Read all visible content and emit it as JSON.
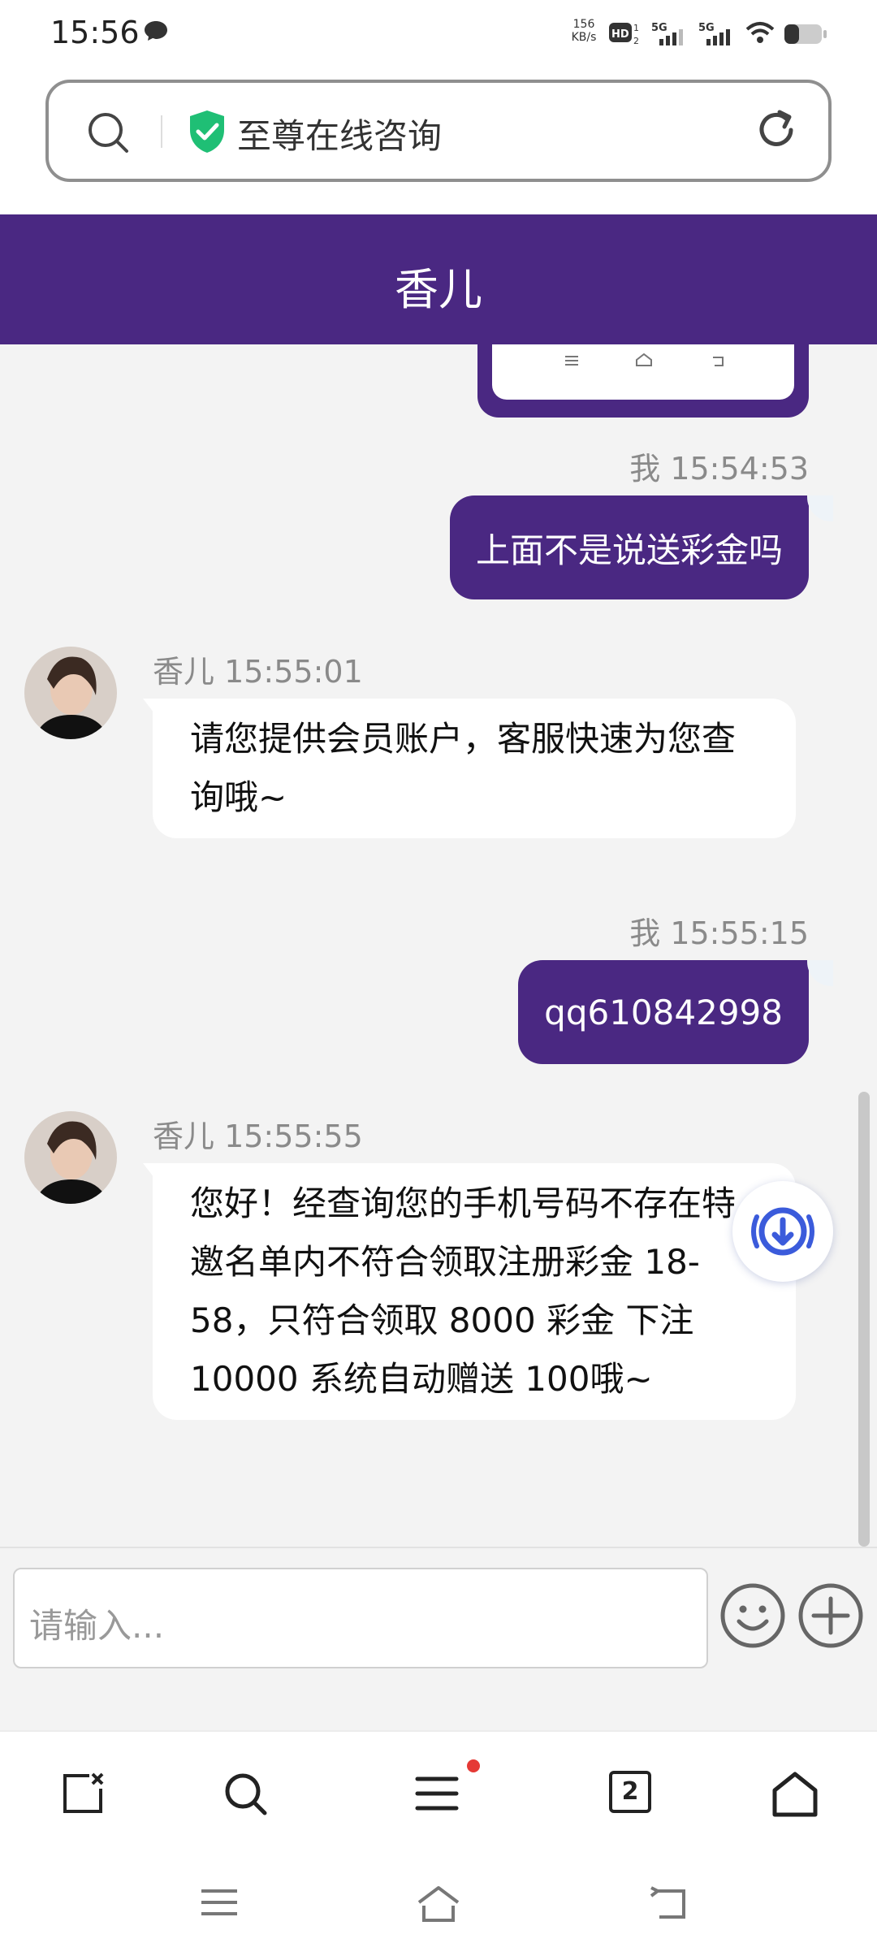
{
  "status_bar": {
    "time": "15:56",
    "net_speed_value": "156",
    "net_speed_unit": "KB/s",
    "hd_label": "HD",
    "sim1_label": "5G",
    "sim2_label": "5G"
  },
  "address_bar": {
    "title": "至尊在线咨询"
  },
  "chat": {
    "header_title": "香儿",
    "messages": [
      {
        "sender": "我",
        "time": "15:54:53",
        "meta": "我 15:54:53",
        "text": "上面不是说送彩金吗",
        "direction": "out"
      },
      {
        "sender": "香儿",
        "time": "15:55:01",
        "meta": "香儿 15:55:01",
        "text": "请您提供会员账户，客服快速为您查询哦~",
        "direction": "in"
      },
      {
        "sender": "我",
        "time": "15:55:15",
        "meta": "我 15:55:15",
        "text": "qq610842998",
        "direction": "out"
      },
      {
        "sender": "香儿",
        "time": "15:55:55",
        "meta": "香儿 15:55:55",
        "text": "您好！经查询您的手机号码不存在特邀名单内不符合领取注册彩金 18-58，只符合领取 8000 彩金 下注10000 系统自动赠送 100哦~",
        "direction": "in"
      }
    ]
  },
  "input": {
    "placeholder": "请输入..."
  },
  "toolbar": {
    "tab_count": "2",
    "has_notification": true
  },
  "colors": {
    "brand_purple": "#4a2882",
    "bubble_in": "#ffffff",
    "background": "#f3f3f3",
    "shield_green": "#1fbf75",
    "download_blue": "#3b5bdb"
  },
  "icons": [
    "search-icon",
    "shield-icon",
    "reload-icon",
    "download-icon",
    "emoji-icon",
    "plus-icon",
    "close-tab-icon",
    "menu-icon",
    "tabs-icon",
    "home-icon",
    "back-icon"
  ]
}
